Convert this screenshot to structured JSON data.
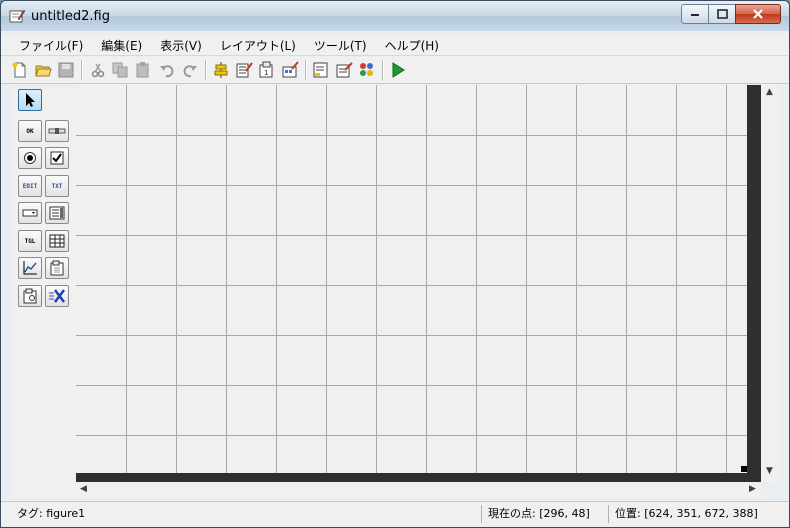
{
  "window": {
    "title": "untitled2.fig"
  },
  "menu": [
    {
      "id": "file",
      "label": "ファイル(F)"
    },
    {
      "id": "edit",
      "label": "編集(E)"
    },
    {
      "id": "view",
      "label": "表示(V)"
    },
    {
      "id": "layout",
      "label": "レイアウト(L)"
    },
    {
      "id": "tools",
      "label": "ツール(T)"
    },
    {
      "id": "help",
      "label": "ヘルプ(H)"
    }
  ],
  "toolbar": [
    "new-file-icon",
    "open-folder-icon",
    "save-icon",
    "cut-icon",
    "copy-icon",
    "paste-icon",
    "undo-icon",
    "redo-icon",
    "align-icon",
    "menu-editor-icon",
    "tab-order-icon",
    "toolbar-editor-icon",
    "mfile-editor-icon",
    "property-inspector-icon",
    "object-browser-icon",
    "run-icon"
  ],
  "palette": {
    "labels": {
      "pushbutton": "OK",
      "slider": "",
      "edit": "EDIT",
      "text": "TXT",
      "toggle": "TGL"
    }
  },
  "status": {
    "tag": "タグ: figure1",
    "current_point": "現在の点:  [296, 48]",
    "position": "位置: [624, 351, 672, 388]"
  },
  "colors": {
    "canvas": "#f0f0f0",
    "grid": "#a8a8a8",
    "border": "#2f2f2f",
    "run": "#1f9a2f"
  }
}
